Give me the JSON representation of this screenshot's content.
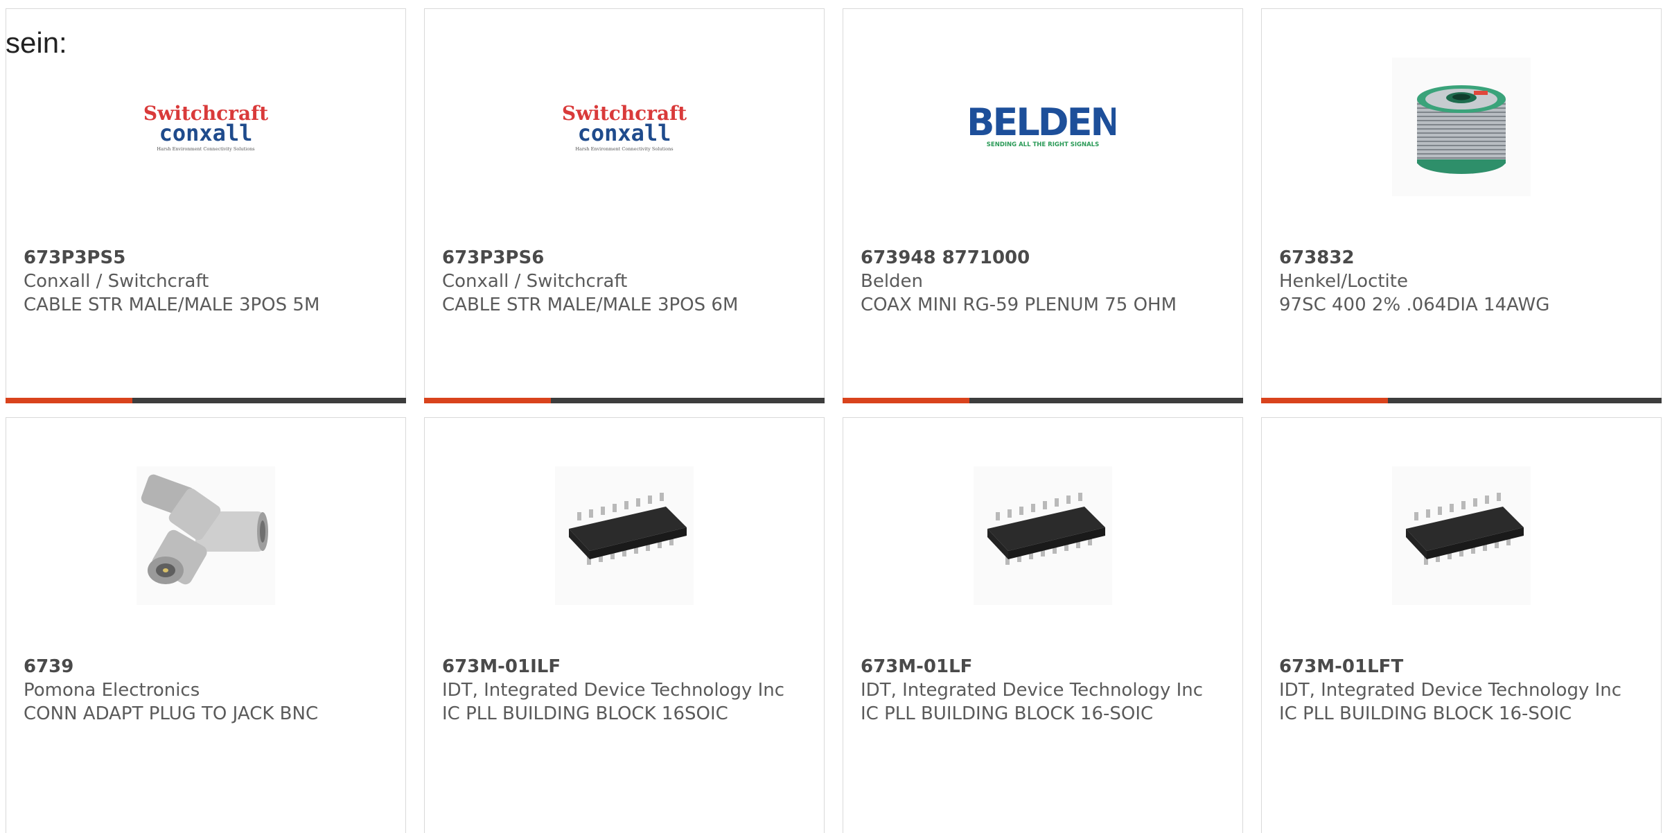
{
  "intro_text": "sein:",
  "colors": {
    "accent": "#d9431d",
    "bar": "#3d3d3d",
    "border": "#d9d9d9",
    "text": "#5a5a5a"
  },
  "products": [
    {
      "part_number": "673P3PS5",
      "manufacturer": "Conxall / Switchcraft",
      "description": "CABLE STR MALE/MALE 3POS 5M",
      "image": "switchcraft-conxall-logo",
      "logo_line1": "Switchcraft",
      "logo_line2": "conxall",
      "logo_tagline": "Harsh Environment Connectivity Solutions"
    },
    {
      "part_number": "673P3PS6",
      "manufacturer": "Conxall / Switchcraft",
      "description": "CABLE STR MALE/MALE 3POS 6M",
      "image": "switchcraft-conxall-logo",
      "logo_line1": "Switchcraft",
      "logo_line2": "conxall",
      "logo_tagline": "Harsh Environment Connectivity Solutions"
    },
    {
      "part_number": "673948 8771000",
      "manufacturer": "Belden",
      "description": "COAX MINI RG-59 PLENUM 75 OHM",
      "image": "belden-logo",
      "logo_line1": "BELDEN",
      "logo_tagline": "SENDING ALL THE RIGHT SIGNALS"
    },
    {
      "part_number": "673832",
      "manufacturer": "Henkel/Loctite",
      "description": "97SC 400 2% .064DIA 14AWG",
      "image": "solder-spool-photo"
    },
    {
      "part_number": "6739",
      "manufacturer": "Pomona Electronics",
      "description": "CONN ADAPT PLUG TO JACK BNC",
      "image": "bnc-adapter-photo"
    },
    {
      "part_number": "673M-01ILF",
      "manufacturer": "IDT, Integrated Device Technology Inc",
      "description": "IC PLL BUILDING BLOCK 16SOIC",
      "image": "soic16-chip-photo"
    },
    {
      "part_number": "673M-01LF",
      "manufacturer": "IDT, Integrated Device Technology Inc",
      "description": "IC PLL BUILDING BLOCK 16-SOIC",
      "image": "soic16-chip-photo"
    },
    {
      "part_number": "673M-01LFT",
      "manufacturer": "IDT, Integrated Device Technology Inc",
      "description": "IC PLL BUILDING BLOCK 16-SOIC",
      "image": "soic16-chip-photo"
    }
  ]
}
